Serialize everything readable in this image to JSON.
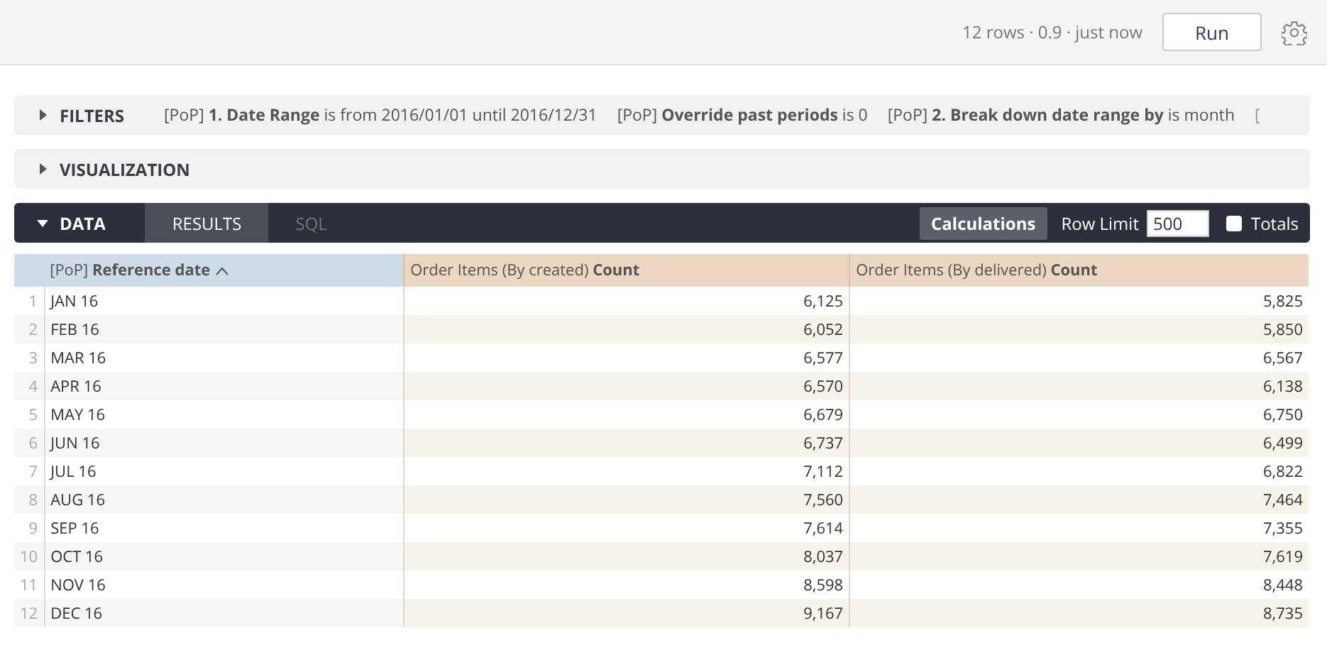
{
  "header": {
    "status": "12 rows · 0.9 · just now",
    "run_button": "Run"
  },
  "filters": {
    "label": "FILTERS",
    "expanded": false,
    "items": [
      "[PoP] **1. Date Range** is from 2016/01/01 until 2016/12/31",
      "[PoP] **Override past periods** is 0",
      "[PoP] **2. Break down date range by** is month",
      "["
    ]
  },
  "visualization": {
    "label": "VISUALIZATION",
    "expanded": false
  },
  "data": {
    "label": "DATA",
    "expanded": true,
    "tabs": [
      {
        "label": "RESULTS",
        "selected": true
      },
      {
        "label": "SQL",
        "selected": false
      }
    ],
    "calculations": "Calculations",
    "row_limit_label": "Row Limit",
    "row_limit": "500",
    "totals_label": "Totals",
    "totals_checked": false
  },
  "table": {
    "columns": [
      {
        "label": "[PoP] **Reference date**",
        "kind": "dimension",
        "sorted": true
      },
      {
        "label": "Order Items (By created) **Count**",
        "kind": "measure",
        "sorted": false
      },
      {
        "label": "Order Items (By delivered) **Count**",
        "kind": "measure",
        "sorted": false
      }
    ],
    "rows": [
      {
        "index": "1",
        "cells": [
          "JAN 16",
          "6,125",
          "5,825"
        ]
      },
      {
        "index": "2",
        "cells": [
          "FEB 16",
          "6,052",
          "5,850"
        ]
      },
      {
        "index": "3",
        "cells": [
          "MAR 16",
          "6,577",
          "6,567"
        ]
      },
      {
        "index": "4",
        "cells": [
          "APR 16",
          "6,570",
          "6,138"
        ]
      },
      {
        "index": "5",
        "cells": [
          "MAY 16",
          "6,679",
          "6,750"
        ]
      },
      {
        "index": "6",
        "cells": [
          "JUN 16",
          "6,737",
          "6,499"
        ]
      },
      {
        "index": "7",
        "cells": [
          "JUL 16",
          "7,112",
          "6,822"
        ]
      },
      {
        "index": "8",
        "cells": [
          "AUG 16",
          "7,560",
          "7,464"
        ]
      },
      {
        "index": "9",
        "cells": [
          "SEP 16",
          "7,614",
          "7,355"
        ]
      },
      {
        "index": "10",
        "cells": [
          "OCT 16",
          "8,037",
          "7,619"
        ]
      },
      {
        "index": "11",
        "cells": [
          "NOV 16",
          "8,598",
          "8,448"
        ]
      },
      {
        "index": "12",
        "cells": [
          "DEC 16",
          "9,167",
          "8,735"
        ]
      }
    ]
  }
}
